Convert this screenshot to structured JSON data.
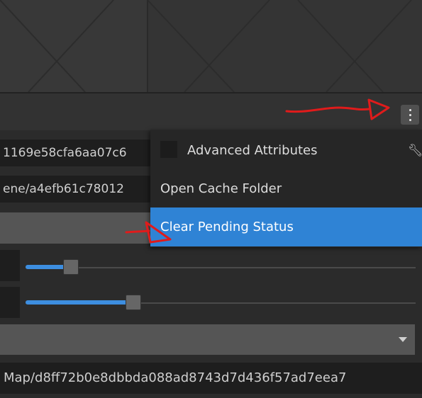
{
  "fields": {
    "hash_value": "1169e58cfa6aa07c6",
    "path_value": "ene/a4efb61c78012",
    "map_path_value": "Map/d8ff72b0e8dbbda088ad8743d7d436f57ad7eea7"
  },
  "context_menu": {
    "items": [
      {
        "label": "Advanced Attributes",
        "icon": "wrench-icon"
      },
      {
        "label": "Open Cache Folder"
      },
      {
        "label": "Clear Pending Status",
        "highlighted": true
      }
    ]
  },
  "sliders": [
    {
      "fraction": 0.11
    },
    {
      "fraction": 0.27
    }
  ],
  "colors": {
    "accent": "#2f83d5",
    "annotation": "#e01b1b"
  },
  "icons": {
    "kebab": "more-vertical-icon",
    "wrench": "wrench-icon",
    "dropdown": "chevron-down-icon"
  }
}
